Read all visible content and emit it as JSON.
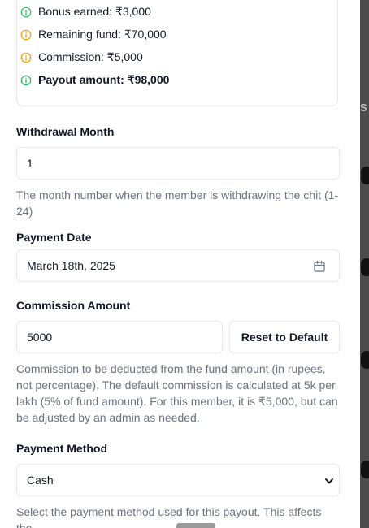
{
  "summary": {
    "items": [
      {
        "label": "Bonus earned: ₹3,000",
        "color": "#22c55e"
      },
      {
        "label": "Remaining fund: ₹70,000",
        "color": "#f59e0b"
      },
      {
        "label": "Commission: ₹5,000",
        "color": "#f59e0b"
      },
      {
        "label": "Payout amount: ₹98,000",
        "color": "#22c55e"
      }
    ]
  },
  "withdrawal": {
    "label": "Withdrawal Month",
    "value": "1",
    "help": "The month number when the member is withdrawing the chit (1-24)"
  },
  "payment_date": {
    "label": "Payment Date",
    "value": "March 18th, 2025",
    "icon": "calendar-icon"
  },
  "commission": {
    "label": "Commission Amount",
    "value": "5000",
    "reset_label": "Reset to Default",
    "help": "Commission to be deducted from the fund amount (in rupees, not percentage). The default commission is calculated at 5k per lakh (5% of fund amount). For this member, it is ₹5,000, but can be adjusted by an admin as needed."
  },
  "payment_method": {
    "label": "Payment Method",
    "selected": "Cash",
    "help": "Select the payment method used for this payout. This affects the"
  },
  "backdrop": {
    "text": "S"
  }
}
